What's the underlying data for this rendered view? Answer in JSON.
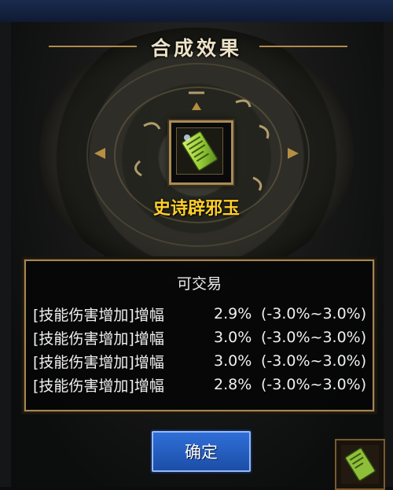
{
  "panel": {
    "title": "合成效果",
    "item_name": "史诗辟邪玉",
    "tradeable": "可交易",
    "stats": [
      {
        "name": "[技能伤害增加]增幅",
        "value": "2.9%",
        "range": "(-3.0%~3.0%)"
      },
      {
        "name": "[技能伤害增加]增幅",
        "value": "3.0%",
        "range": "(-3.0%~3.0%)"
      },
      {
        "name": "[技能伤害增加]增幅",
        "value": "3.0%",
        "range": "(-3.0%~3.0%)"
      },
      {
        "name": "[技能伤害增加]增幅",
        "value": "2.8%",
        "range": "(-3.0%~3.0%)"
      }
    ],
    "confirm_label": "确定"
  },
  "icons": {
    "item_icon": "jade-amulet-card-icon",
    "side_icon": "jade-amulet-card-icon"
  },
  "colors": {
    "item_name": "#ffcf2a",
    "frame_gold": "#a88c58",
    "button_blue": "#2f6fd8"
  }
}
